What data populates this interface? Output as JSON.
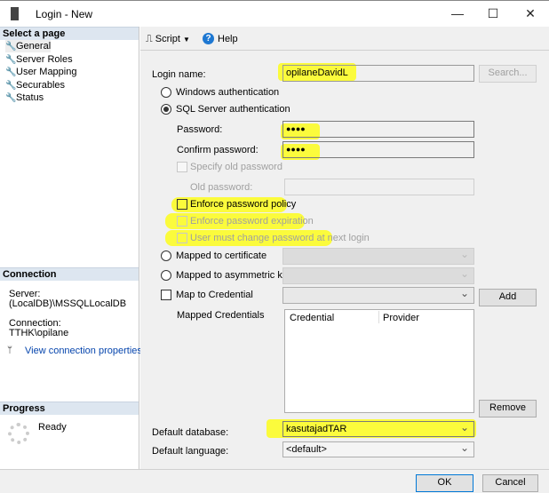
{
  "window": {
    "title": "Login - New",
    "minimize": "—",
    "maximize": "☐",
    "close": "✕"
  },
  "sidebar": {
    "header": "Select a page",
    "items": [
      {
        "label": "General"
      },
      {
        "label": "Server Roles"
      },
      {
        "label": "User Mapping"
      },
      {
        "label": "Securables"
      },
      {
        "label": "Status"
      }
    ]
  },
  "connection": {
    "header": "Connection",
    "server_label": "Server:",
    "server": "(LocalDB)\\MSSQLLocalDB",
    "connection_label": "Connection:",
    "connection": "TTHK\\opilane",
    "link": "View connection properties"
  },
  "progress": {
    "header": "Progress",
    "status": "Ready"
  },
  "toolbar": {
    "script": "Script",
    "help": "Help"
  },
  "form": {
    "login_name_label": "Login name:",
    "login_name": "opilaneDavidL",
    "search": "Search...",
    "windows_auth": "Windows authentication",
    "sql_auth": "SQL Server authentication",
    "password_label": "Password:",
    "password": "●●●●",
    "confirm_label": "Confirm password:",
    "confirm": "●●●●",
    "specify_old": "Specify old password",
    "old_password_label": "Old password:",
    "enforce_policy": "Enforce password policy",
    "enforce_expiration": "Enforce password expiration",
    "must_change": "User must change password at next login",
    "mapped_cert": "Mapped to certificate",
    "mapped_asym": "Mapped to asymmetric key",
    "map_credential": "Map to Credential",
    "add": "Add",
    "mapped_credentials_label": "Mapped Credentials",
    "cred_columns": [
      "Credential",
      "Provider"
    ],
    "remove": "Remove",
    "default_db_label": "Default database:",
    "default_db": "kasutajadTAR",
    "default_lang_label": "Default language:",
    "default_lang": "<default>"
  },
  "buttons": {
    "ok": "OK",
    "cancel": "Cancel"
  }
}
